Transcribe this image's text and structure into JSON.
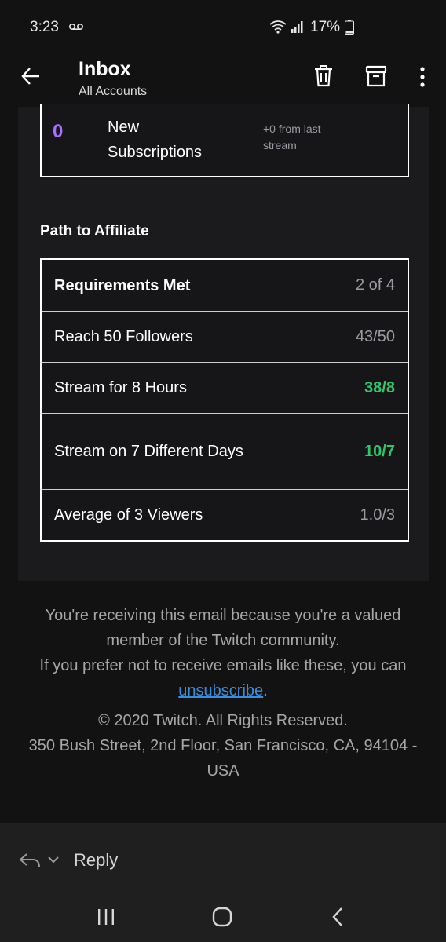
{
  "status_bar": {
    "time": "3:23",
    "battery": "17%"
  },
  "app_bar": {
    "title": "Inbox",
    "subtitle": "All Accounts"
  },
  "subscriptions": {
    "count": "0",
    "label": "New Subscriptions",
    "delta": "+0 from last stream"
  },
  "affiliate": {
    "title": "Path to Affiliate",
    "rows": [
      {
        "label": "Requirements Met",
        "value": "2 of 4"
      },
      {
        "label": "Reach 50 Followers",
        "value": "43/50"
      },
      {
        "label": "Stream for 8 Hours",
        "value": "38/8"
      },
      {
        "label": "Stream on 7 Different Days",
        "value": "10/7"
      },
      {
        "label": "Average of 3 Viewers",
        "value": "1.0/3"
      }
    ]
  },
  "footer": {
    "line1": "You're receiving this email because you're a valued member of the Twitch community.",
    "line2_prefix": "If you prefer not to receive emails like these, you can",
    "unsubscribe": "unsubscribe",
    "line2_suffix": ".",
    "copyright": "© 2020 Twitch. All Rights Reserved.",
    "address": "350 Bush Street, 2nd Floor, San Francisco, CA, 94104 - USA"
  },
  "reply_bar": {
    "reply_label": "Reply"
  },
  "colors": {
    "accent_purple": "#a970ff",
    "success_green": "#2fc56b",
    "link_blue": "#3b8ede"
  },
  "icons": [
    "voicemail-icon",
    "wifi-icon",
    "signal-icon",
    "battery-icon",
    "back-arrow-icon",
    "trash-icon",
    "archive-icon",
    "more-vertical-icon",
    "reply-icon",
    "chevron-down-icon",
    "nav-recents-icon",
    "nav-home-icon",
    "nav-back-icon"
  ]
}
